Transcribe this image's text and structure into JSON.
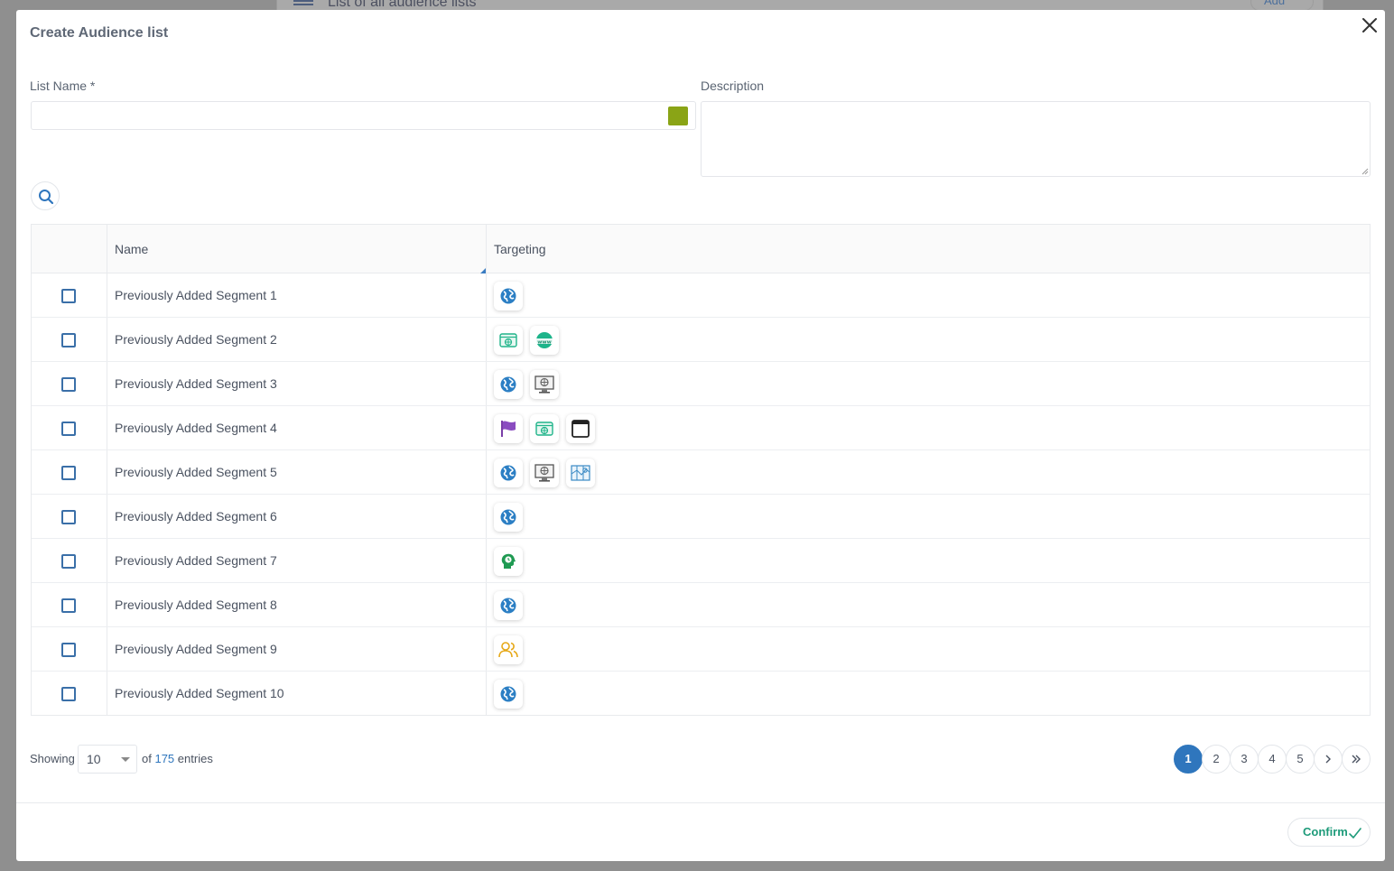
{
  "background": {
    "title": "List of all audience lists",
    "add_label": "Add"
  },
  "modal": {
    "title": "Create Audience list",
    "list_name_label": "List Name *",
    "list_name_value": "",
    "list_name_color": "#8aa416",
    "description_label": "Description",
    "description_value": ""
  },
  "table": {
    "columns": [
      "",
      "Name",
      "Targeting"
    ],
    "rows": [
      {
        "name": "Previously Added Segment 1",
        "targeting": [
          "globe-icon"
        ]
      },
      {
        "name": "Previously Added Segment 2",
        "targeting": [
          "browser-globe-icon",
          "www-icon"
        ]
      },
      {
        "name": "Previously Added Segment 3",
        "targeting": [
          "globe-icon",
          "monitor-globe-icon"
        ]
      },
      {
        "name": "Previously Added Segment 4",
        "targeting": [
          "flag-icon",
          "browser-globe-icon",
          "window-icon"
        ]
      },
      {
        "name": "Previously Added Segment 5",
        "targeting": [
          "globe-icon",
          "monitor-globe-icon",
          "map-icon"
        ]
      },
      {
        "name": "Previously Added Segment 6",
        "targeting": [
          "globe-icon"
        ]
      },
      {
        "name": "Previously Added Segment 7",
        "targeting": [
          "head-clock-icon"
        ]
      },
      {
        "name": "Previously Added Segment 8",
        "targeting": [
          "globe-icon"
        ]
      },
      {
        "name": "Previously Added Segment 9",
        "targeting": [
          "users-icon"
        ]
      },
      {
        "name": "Previously Added Segment 10",
        "targeting": [
          "globe-icon"
        ]
      }
    ]
  },
  "footer": {
    "showing_label": "Showing",
    "page_length": "10",
    "of_label": "of",
    "total_count": "175",
    "entries_label": "entries",
    "pages": [
      "1",
      "2",
      "3",
      "4",
      "5"
    ],
    "current_page": "1",
    "confirm_label": "Confirm"
  },
  "colors": {
    "accent": "#2f76bd",
    "confirm": "#1e9b7a",
    "checkbox": "#3a6fa8"
  }
}
